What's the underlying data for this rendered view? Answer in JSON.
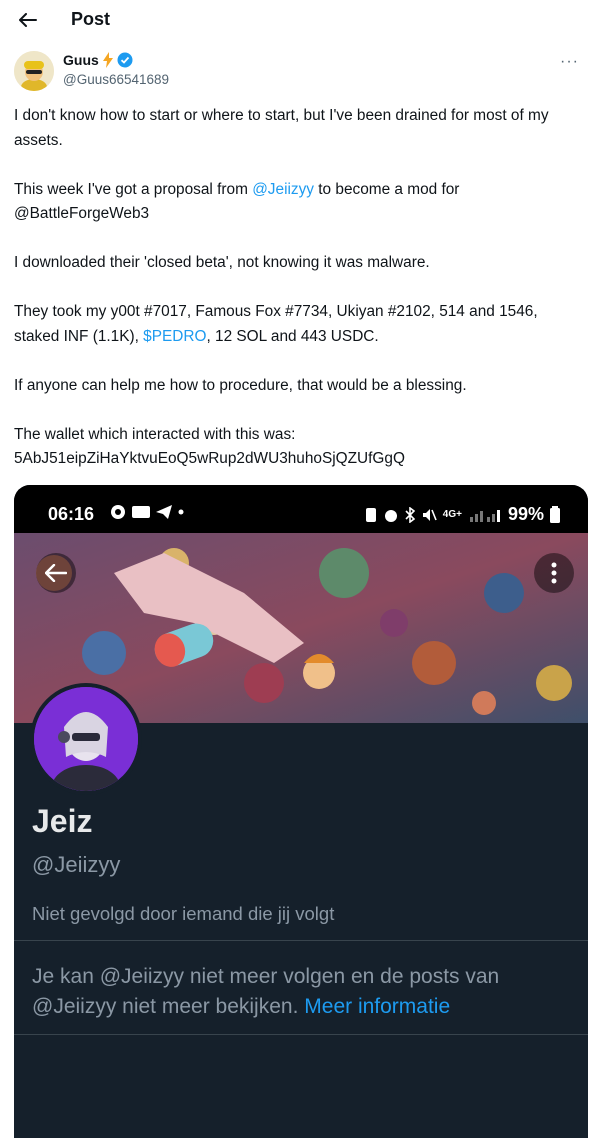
{
  "header": {
    "title": "Post"
  },
  "author": {
    "name": "Guus",
    "handle": "@Guus66541689"
  },
  "post": {
    "p1": "I don't know how to start or where to start, but I've been drained for most of my assets.",
    "p2_prefix": "This week I've got a proposal from ",
    "p2_mention": "@Jeiizyy",
    "p2_suffix": " to become a mod for @BattleForgeWeb3",
    "p3": "I downloaded their 'closed beta', not knowing it was malware.",
    "p4_prefix": "They took my y00t #7017, Famous Fox #7734, Ukiyan #2102, 514 and 1546, staked INF (1.1K), ",
    "p4_cashtag": "$PEDRO",
    "p4_suffix": ", 12 SOL and 443 USDC.",
    "p5": "If anyone can help me how to procedure, that would be a blessing.",
    "p6_line1": "The wallet which interacted with this was:",
    "p6_line2": "5AbJ51eipZiHaYktvuEoQ5wRup2dWU3huhoSjQZUfGgQ"
  },
  "screenshot": {
    "status_time": "06:16",
    "status_battery": "99%",
    "status_network": "4G+",
    "profile_name": "Jeiz",
    "profile_handle": "@Jeiizyy",
    "followed_by": "Niet gevolgd door iemand die jij volgt",
    "notice_text": "Je kan @Jeiizyy niet meer volgen en de posts van @Jeiizyy niet meer bekijken. ",
    "notice_link": "Meer informatie"
  },
  "colors": {
    "accent": "#1d9bf0",
    "dark_bg": "#15202b",
    "muted": "#536471"
  },
  "icons": [
    "back-arrow-icon",
    "lightning-icon",
    "verified-badge-icon",
    "more-icon"
  ]
}
